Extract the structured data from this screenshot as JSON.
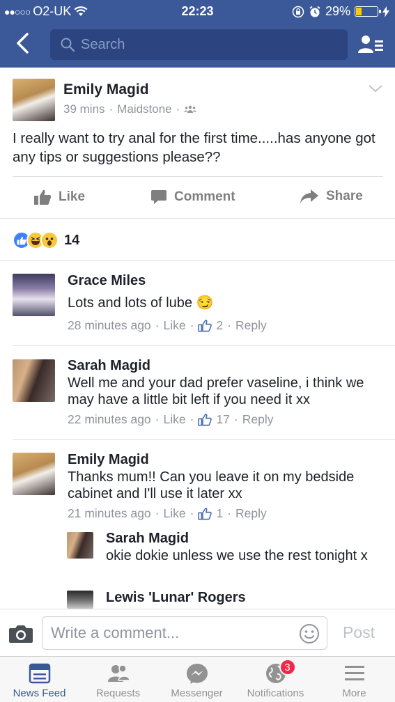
{
  "status_bar": {
    "carrier": "O2-UK",
    "time": "22:23",
    "battery": "29%",
    "battery_level": 0.29
  },
  "nav": {
    "search_placeholder": "Search"
  },
  "post": {
    "author": "Emily Magid",
    "time": "39 mins",
    "location": "Maidstone",
    "text": "I really want to try anal for the first time.....has anyone got any tips or suggestions please??",
    "actions": {
      "like": "Like",
      "comment": "Comment",
      "share": "Share"
    },
    "reaction_count": "14"
  },
  "comments": [
    {
      "name": "Grace Miles",
      "text": "Lots and lots of lube 😏",
      "time": "28 minutes ago",
      "like": "Like",
      "likes": "2",
      "reply": "Reply"
    },
    {
      "name": "Sarah Magid",
      "text": "Well me and your dad prefer vaseline, i think we may have a little bit left if you need it xx",
      "time": "22 minutes ago",
      "like": "Like",
      "likes": "17",
      "reply": "Reply"
    },
    {
      "name": "Emily Magid",
      "text": "Thanks mum!! Can you leave it on my bedside cabinet and I'll use it later xx",
      "time": "21 minutes ago",
      "like": "Like",
      "likes": "1",
      "reply": "Reply"
    }
  ],
  "replies": [
    {
      "name": "Sarah Magid",
      "text": "okie dokie unless we use the rest tonight x"
    },
    {
      "name": "Lewis 'Lunar' Rogers"
    }
  ],
  "composer": {
    "placeholder": "Write a comment...",
    "post": "Post"
  },
  "tabs": [
    {
      "label": "News Feed"
    },
    {
      "label": "Requests"
    },
    {
      "label": "Messenger"
    },
    {
      "label": "Notifications",
      "badge": "3"
    },
    {
      "label": "More"
    }
  ],
  "colors": {
    "brand": "#3b5998",
    "like_blue": "#4080ff",
    "badge_red": "#f02849"
  }
}
